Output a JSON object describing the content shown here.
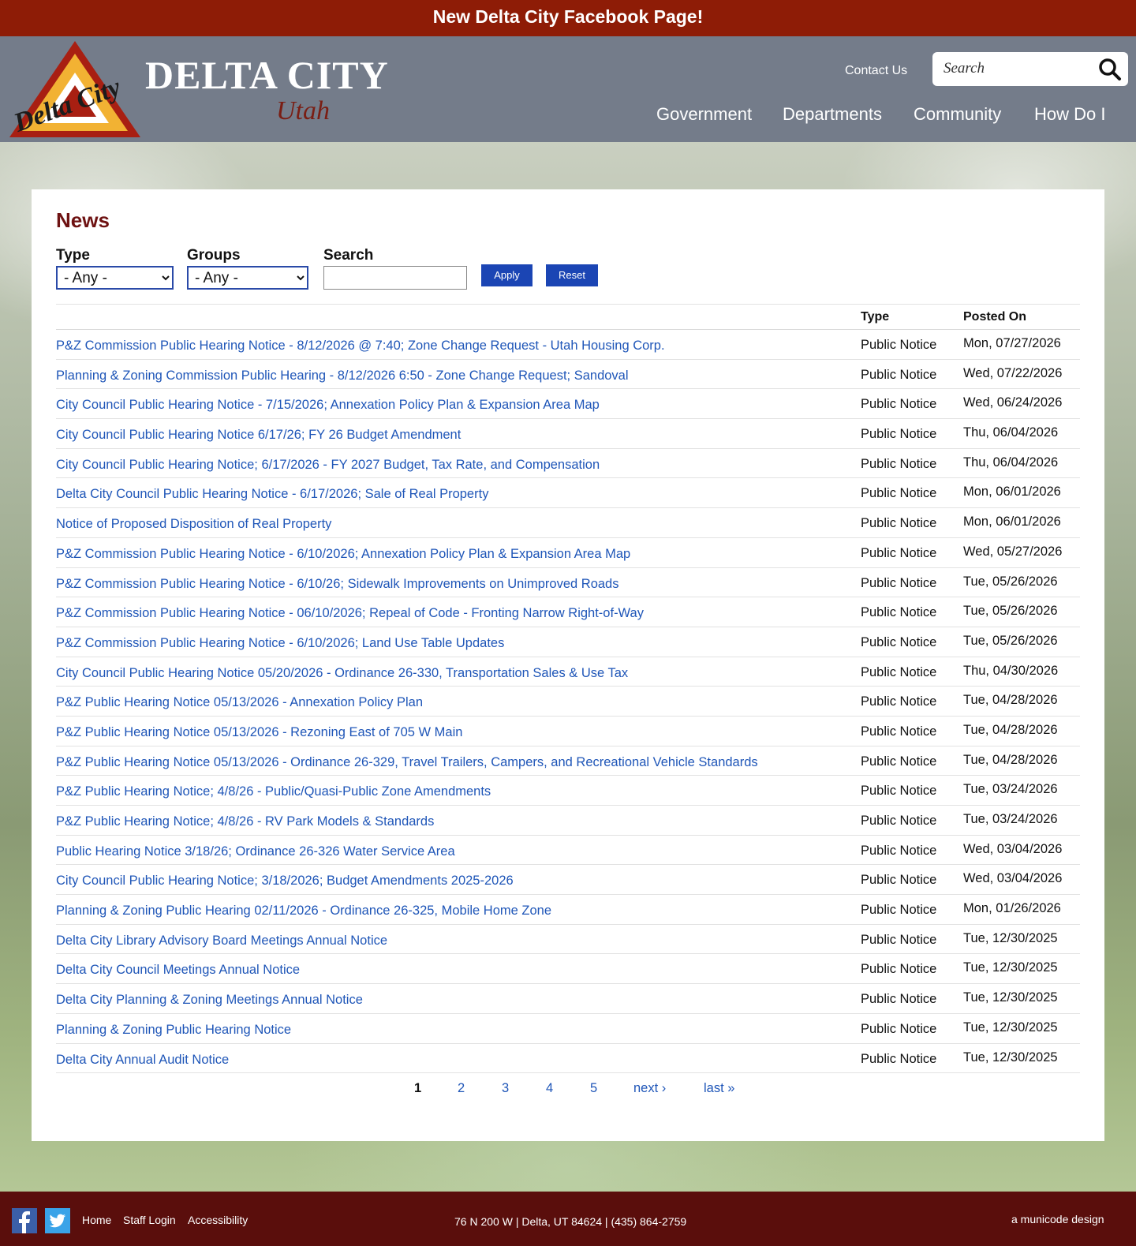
{
  "banner": {
    "text": "New Delta City Facebook Page!"
  },
  "header": {
    "logo_text": "Delta City",
    "site_title": "DELTA CITY",
    "site_subtitle": "Utah",
    "contact_label": "Contact Us",
    "search_placeholder": "Search",
    "nav": [
      "Government",
      "Departments",
      "Community",
      "How Do I"
    ]
  },
  "news": {
    "title": "News",
    "filters": {
      "type_label": "Type",
      "type_value": "- Any -",
      "groups_label": "Groups",
      "groups_value": "- Any -",
      "search_label": "Search",
      "search_value": "",
      "apply_label": "Apply",
      "reset_label": "Reset"
    },
    "columns": {
      "title": "",
      "type": "Type",
      "posted": "Posted On"
    },
    "rows": [
      {
        "title": "P&Z Commission Public Hearing Notice - 8/12/2026 @ 7:40; Zone Change Request - Utah Housing Corp.",
        "type": "Public Notice",
        "date": "Mon, 07/27/2026"
      },
      {
        "title": "Planning & Zoning Commission Public Hearing - 8/12/2026 6:50 - Zone Change Request; Sandoval",
        "type": "Public Notice",
        "date": "Wed, 07/22/2026"
      },
      {
        "title": "City Council Public Hearing Notice - 7/15/2026; Annexation Policy Plan & Expansion Area Map",
        "type": "Public Notice",
        "date": "Wed, 06/24/2026"
      },
      {
        "title": "City Council Public Hearing Notice 6/17/26; FY 26 Budget Amendment",
        "type": "Public Notice",
        "date": "Thu, 06/04/2026"
      },
      {
        "title": "City Council Public Hearing Notice; 6/17/2026 - FY 2027 Budget, Tax Rate, and Compensation",
        "type": "Public Notice",
        "date": "Thu, 06/04/2026"
      },
      {
        "title": "Delta City Council Public Hearing Notice - 6/17/2026; Sale of Real Property",
        "type": "Public Notice",
        "date": "Mon, 06/01/2026"
      },
      {
        "title": "Notice of Proposed Disposition of Real Property",
        "type": "Public Notice",
        "date": "Mon, 06/01/2026"
      },
      {
        "title": "P&Z Commission Public Hearing Notice - 6/10/2026; Annexation Policy Plan & Expansion Area Map",
        "type": "Public Notice",
        "date": "Wed, 05/27/2026"
      },
      {
        "title": "P&Z Commission Public Hearing Notice - 6/10/26; Sidewalk Improvements on Unimproved Roads",
        "type": "Public Notice",
        "date": "Tue, 05/26/2026"
      },
      {
        "title": "P&Z Commission Public Hearing Notice - 06/10/2026; Repeal of Code - Fronting Narrow Right-of-Way",
        "type": "Public Notice",
        "date": "Tue, 05/26/2026"
      },
      {
        "title": "P&Z Commission Public Hearing Notice - 6/10/2026; Land Use Table Updates",
        "type": "Public Notice",
        "date": "Tue, 05/26/2026"
      },
      {
        "title": "City Council Public Hearing Notice 05/20/2026 - Ordinance 26-330, Transportation Sales & Use Tax",
        "type": "Public Notice",
        "date": "Thu, 04/30/2026"
      },
      {
        "title": "P&Z Public Hearing Notice 05/13/2026 - Annexation Policy Plan",
        "type": "Public Notice",
        "date": "Tue, 04/28/2026"
      },
      {
        "title": "P&Z Public Hearing Notice 05/13/2026 - Rezoning East of 705 W Main",
        "type": "Public Notice",
        "date": "Tue, 04/28/2026"
      },
      {
        "title": "P&Z Public Hearing Notice 05/13/2026 - Ordinance 26-329, Travel Trailers, Campers, and Recreational Vehicle Standards",
        "type": "Public Notice",
        "date": "Tue, 04/28/2026"
      },
      {
        "title": "P&Z Public Hearing Notice; 4/8/26 - Public/Quasi-Public Zone Amendments",
        "type": "Public Notice",
        "date": "Tue, 03/24/2026"
      },
      {
        "title": "P&Z Public Hearing Notice; 4/8/26 - RV Park Models & Standards",
        "type": "Public Notice",
        "date": "Tue, 03/24/2026"
      },
      {
        "title": "Public Hearing Notice 3/18/26; Ordinance 26-326 Water Service Area",
        "type": "Public Notice",
        "date": "Wed, 03/04/2026"
      },
      {
        "title": "City Council Public Hearing Notice; 3/18/2026; Budget Amendments 2025-2026",
        "type": "Public Notice",
        "date": "Wed, 03/04/2026"
      },
      {
        "title": "Planning & Zoning Public Hearing 02/11/2026 - Ordinance 26-325, Mobile Home Zone",
        "type": "Public Notice",
        "date": "Mon, 01/26/2026"
      },
      {
        "title": "Delta City Library Advisory Board Meetings Annual Notice",
        "type": "Public Notice",
        "date": "Tue, 12/30/2025"
      },
      {
        "title": "Delta City Council Meetings Annual Notice",
        "type": "Public Notice",
        "date": "Tue, 12/30/2025"
      },
      {
        "title": "Delta City Planning & Zoning Meetings Annual Notice",
        "type": "Public Notice",
        "date": "Tue, 12/30/2025"
      },
      {
        "title": "Planning & Zoning Public Hearing Notice",
        "type": "Public Notice",
        "date": "Tue, 12/30/2025"
      },
      {
        "title": "Delta City Annual Audit Notice",
        "type": "Public Notice",
        "date": "Tue, 12/30/2025"
      }
    ],
    "pager": [
      "1",
      "2",
      "3",
      "4",
      "5",
      "next ›",
      "last »"
    ]
  },
  "footer": {
    "links": [
      "Home",
      "Staff Login",
      "Accessibility"
    ],
    "address": "76 N 200 W | Delta, UT 84624 | (435) 864-2759",
    "credit": "a municode design"
  },
  "colors": {
    "banner": "#8e1c06",
    "header": "#747c8a",
    "title": "#6e1212",
    "link": "#1f56b8",
    "button": "#1b45b4",
    "footer": "#5a0e0c"
  }
}
